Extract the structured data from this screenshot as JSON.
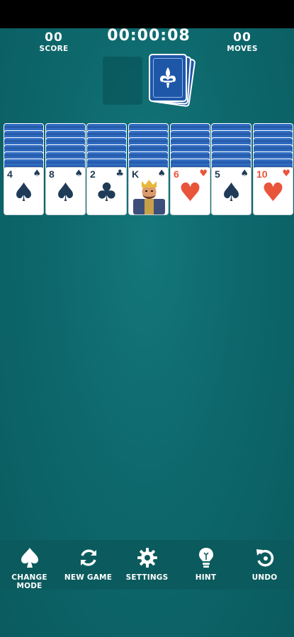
{
  "hud": {
    "score_value": "00",
    "score_label": "SCORE",
    "timer": "00:00:08",
    "moves_value": "00",
    "moves_label": "MOVES"
  },
  "colors": {
    "felt": "#0c6468",
    "card_back": "#2a62b6",
    "black_suit": "#1f3b57",
    "red_suit": "#e8553a"
  },
  "stock": {
    "icon": "fleur-de-lis-icon"
  },
  "columns": [
    {
      "rank": "4",
      "suit": "spade",
      "suit_glyph": "♠",
      "color": "black",
      "facedown_count": 6
    },
    {
      "rank": "8",
      "suit": "spade",
      "suit_glyph": "♠",
      "color": "black",
      "facedown_count": 6
    },
    {
      "rank": "2",
      "suit": "club",
      "suit_glyph": "♣",
      "color": "black",
      "facedown_count": 6
    },
    {
      "rank": "K",
      "suit": "spade",
      "suit_glyph": "♠",
      "color": "black",
      "facedown_count": 6,
      "art": "king-portrait"
    },
    {
      "rank": "6",
      "suit": "heart",
      "suit_glyph": "♥",
      "color": "red",
      "facedown_count": 6
    },
    {
      "rank": "5",
      "suit": "spade",
      "suit_glyph": "♠",
      "color": "black",
      "facedown_count": 6
    },
    {
      "rank": "10",
      "suit": "heart",
      "suit_glyph": "♥",
      "color": "red",
      "facedown_count": 6
    }
  ],
  "toolbar": {
    "change_mode": {
      "label": "CHANGE MODE",
      "icon": "spade-icon"
    },
    "new_game": {
      "label": "NEW GAME",
      "icon": "refresh-icon"
    },
    "settings": {
      "label": "SETTINGS",
      "icon": "gear-icon"
    },
    "hint": {
      "label": "HINT",
      "icon": "lightbulb-icon"
    },
    "undo": {
      "label": "UNDO",
      "icon": "undo-icon"
    }
  }
}
